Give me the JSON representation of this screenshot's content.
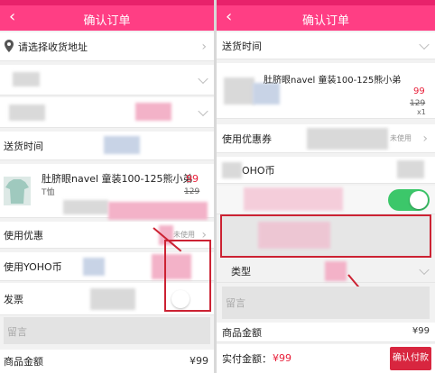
{
  "app": {
    "title": "确认订单",
    "accent": "#ff3e84",
    "brand_red": "#e8203a"
  },
  "left": {
    "address_label": "请选择收货地址",
    "delivery_time_label": "送货时间",
    "product": {
      "name": "肚脐眼navel 童装100-125熊小弟",
      "name_line2": "T恤",
      "price": "99",
      "original_price": "129"
    },
    "coupon_label": "使用优惠",
    "coupon_status": "未使用",
    "yoho_label": "使用YOHO币",
    "invoice_label": "发票",
    "note_placeholder": "留言",
    "goods_amount_label": "商品金额",
    "goods_amount_value": "¥99"
  },
  "right": {
    "delivery_time_label": "送货时间",
    "product": {
      "name": "肚脐眼navel 童装100-125熊小弟",
      "price": "99",
      "original_price": "129",
      "quantity": "x1"
    },
    "coupon_label": "使用优惠券",
    "coupon_status": "未使用",
    "yoho_label": "OHO币",
    "invoice_type_label": "类型",
    "note_placeholder": "留言",
    "goods_amount_label": "商品金额",
    "goods_amount_value": "¥99",
    "paid_amount_label": "实付金额：",
    "paid_amount_value": "¥99",
    "confirm_pay_label": "确认付款"
  }
}
